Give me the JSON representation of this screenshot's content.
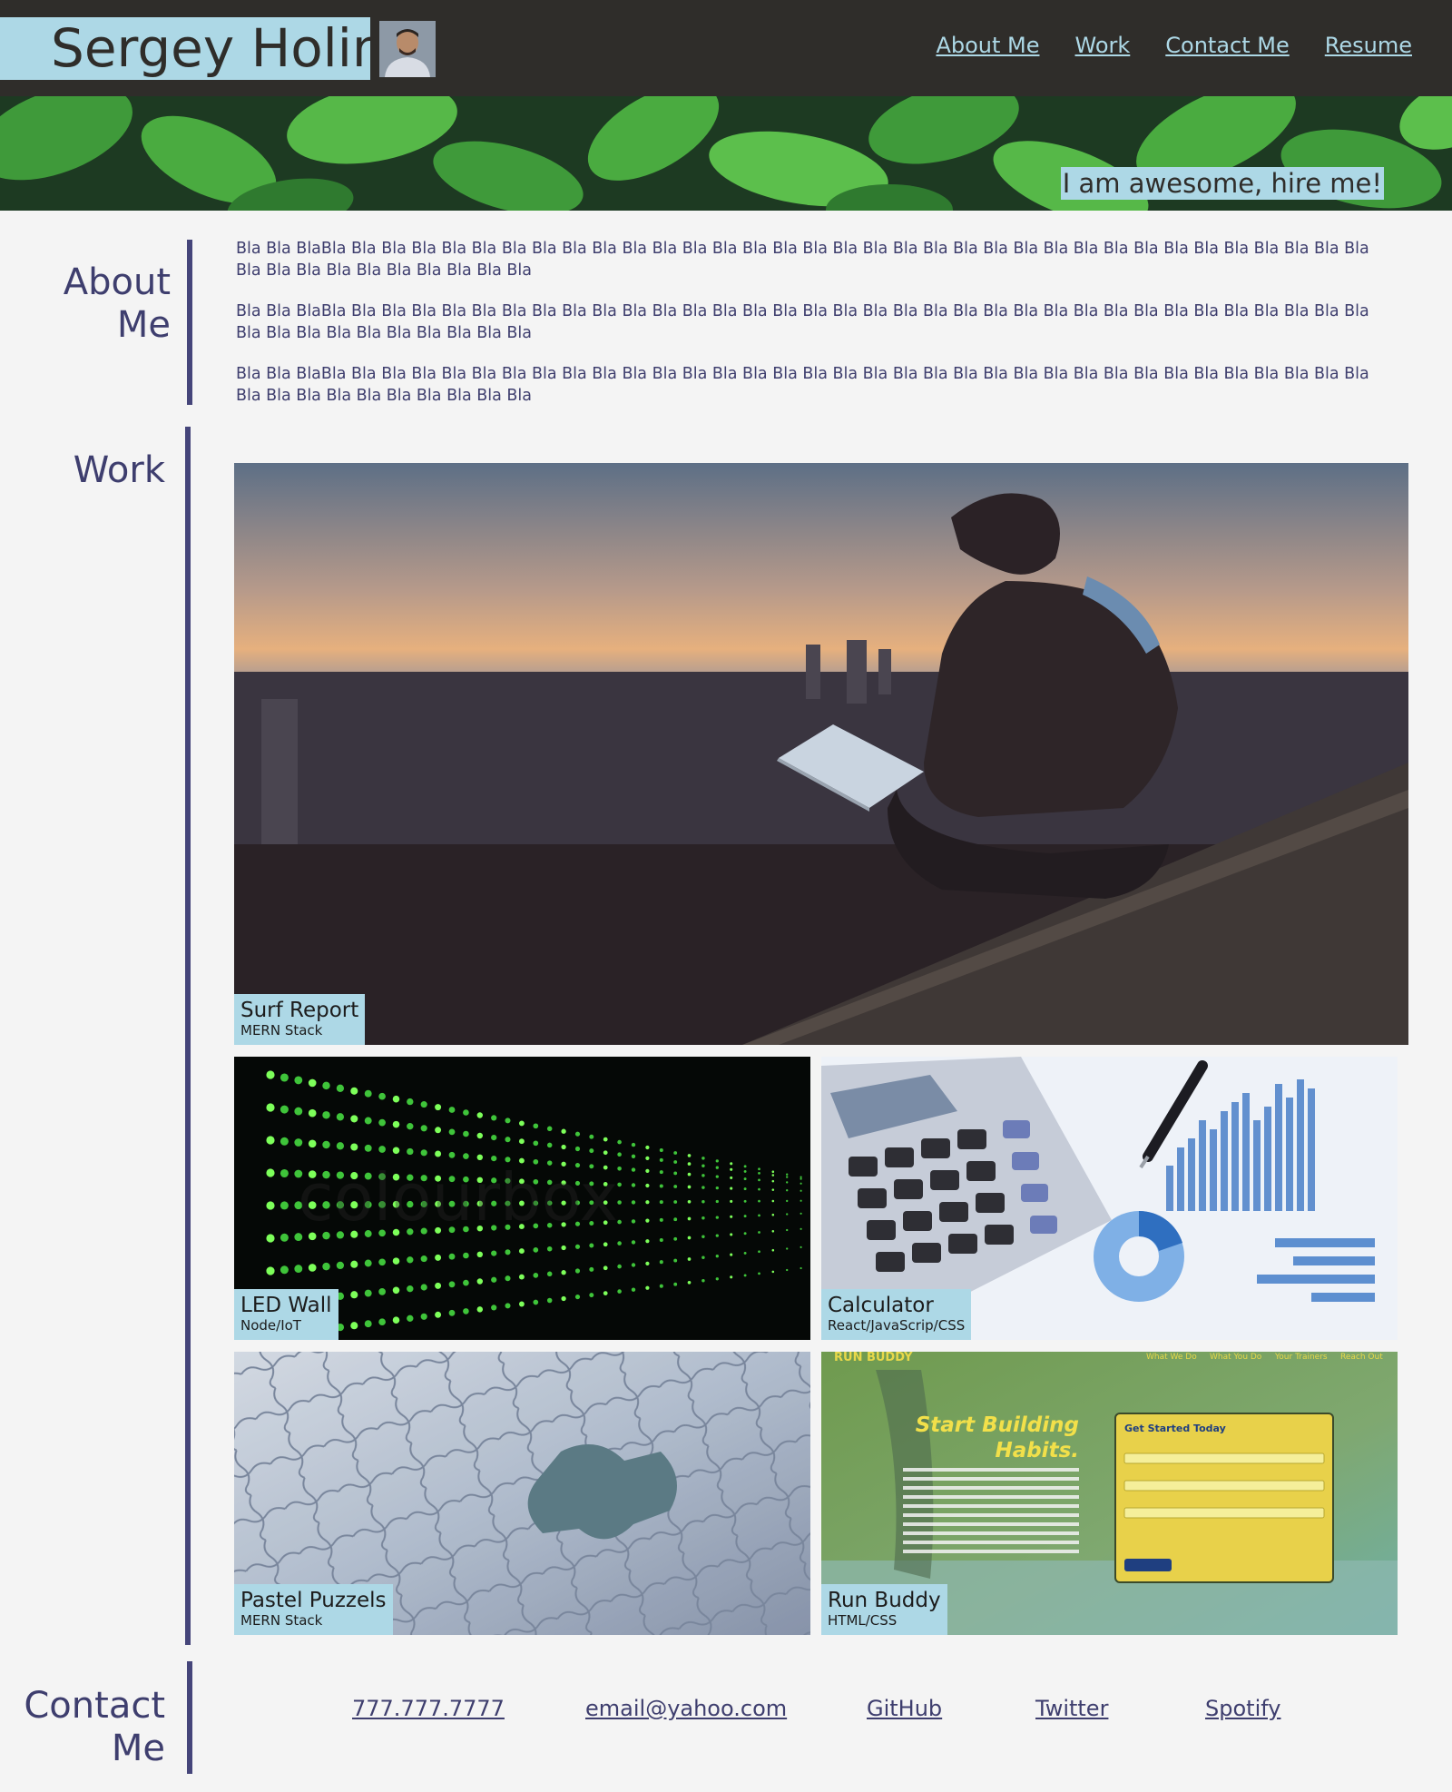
{
  "header": {
    "brand": "Sergey Holin",
    "nav": [
      "About Me",
      "Work",
      "Contact Me",
      "Resume"
    ]
  },
  "hero": {
    "tagline": "I am awesome, hire me!"
  },
  "about": {
    "title_line1": "About",
    "title_line2": "Me",
    "paragraphs": [
      "Bla Bla BlaBla Bla Bla Bla Bla Bla Bla Bla Bla Bla Bla Bla Bla Bla Bla Bla Bla Bla Bla Bla Bla Bla Bla Bla Bla Bla Bla Bla Bla Bla Bla Bla Bla Bla Bla Bla Bla Bla Bla Bla Bla Bla Bla Bla Bla",
      "Bla Bla BlaBla Bla Bla Bla Bla Bla Bla Bla Bla Bla Bla Bla Bla Bla Bla Bla Bla Bla Bla Bla Bla Bla Bla Bla Bla Bla Bla Bla Bla Bla Bla Bla Bla Bla Bla Bla Bla Bla Bla Bla Bla Bla Bla Bla Bla",
      "Bla Bla BlaBla Bla Bla Bla Bla Bla Bla Bla Bla Bla Bla Bla Bla Bla Bla Bla Bla Bla Bla Bla Bla Bla Bla Bla Bla Bla Bla Bla Bla Bla Bla Bla Bla Bla Bla Bla Bla Bla Bla Bla Bla Bla Bla Bla Bla"
    ]
  },
  "work": {
    "title": "Work",
    "projects": [
      {
        "title": "Surf Report",
        "stack": "MERN Stack"
      },
      {
        "title": "LED Wall",
        "stack": "Node/IoT"
      },
      {
        "title": "Calculator",
        "stack": "React/JavaScrip/CSS"
      },
      {
        "title": "Pastel Puzzels",
        "stack": "MERN Stack"
      },
      {
        "title": "Run Buddy",
        "stack": "HTML/CSS"
      }
    ],
    "led_watermark": "colourbox",
    "run_buddy_screenshot": {
      "logo": "RUN BUDDY",
      "nav": [
        "What We Do",
        "What You Do",
        "Your Trainers",
        "Reach Out"
      ],
      "headline_1": "Start Building",
      "headline_2": "Habits.",
      "form_title": "Get Started Today"
    }
  },
  "contact": {
    "title_line1": "Contact",
    "title_line2": "Me",
    "links": [
      "777.777.7777",
      "email@yahoo.com",
      "GitHub",
      "Twitter",
      "Spotify"
    ]
  },
  "colors": {
    "header_bg": "#2f2d2a",
    "accent_light_blue": "#add8e6",
    "text_navy": "#3e3e6e",
    "page_bg": "#f4f4f4"
  }
}
